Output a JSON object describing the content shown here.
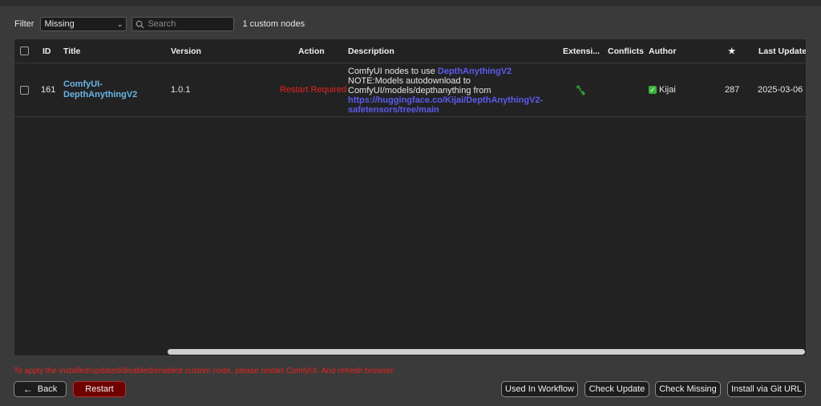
{
  "filter": {
    "label": "Filter",
    "selected": "Missing",
    "search_placeholder": "Search",
    "count_text": "1 custom nodes"
  },
  "table": {
    "headers": {
      "id": "ID",
      "title": "Title",
      "version": "Version",
      "action": "Action",
      "description": "Description",
      "extensions": "Extensi...",
      "conflicts": "Conflicts",
      "author": "Author",
      "stars": "★",
      "last_update": "Last Update"
    },
    "rows": [
      {
        "id": "161",
        "title_line1": "ComfyUI-",
        "title_line2": "DepthAnythingV2",
        "version": "1.0.1",
        "action": "Restart Required",
        "desc_text1": "ComfyUI nodes to use ",
        "desc_link1": "DepthAnythingV2",
        "desc_line2": "NOTE:Models autodownload to",
        "desc_line3": "ComfyUI/models/depthanything from",
        "desc_link2_line1": "https://huggingface.co/Kijai/DepthAnythingV2-",
        "desc_link2_line2": "safetensors/tree/main",
        "extension_icon": "puzzle-link-icon",
        "author": "Kijai",
        "stars": "287",
        "last_update": "2025-03-06"
      }
    ]
  },
  "notice": "To apply the installed/updated/disabled/enabled custom node, please restart ComfyUI. And refresh browser.",
  "buttons": {
    "back": "Back",
    "restart": "Restart",
    "used_in_workflow": "Used In Workflow",
    "check_update": "Check Update",
    "check_missing": "Check Missing",
    "install_git": "Install via Git URL"
  },
  "colors": {
    "background": "#3a3a3a",
    "table_bg": "#222222",
    "title_link": "#69b4e6",
    "desc_link": "#5b5bf0",
    "warning_red": "#e8231e",
    "restart_button": "#6e0000",
    "author_check": "#3cb33c"
  }
}
